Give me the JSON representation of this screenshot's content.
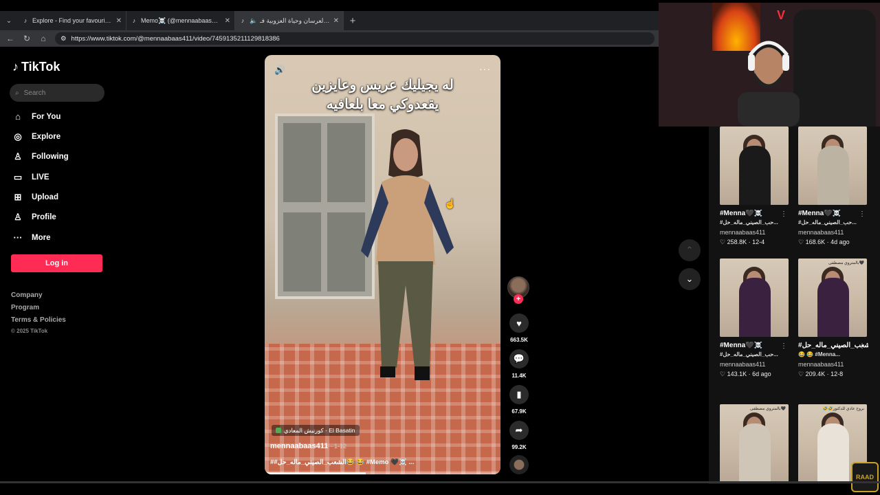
{
  "browser": {
    "tabs": [
      {
        "title": "Explore - Find your favourite video",
        "icon": "tiktok-icon",
        "active": false
      },
      {
        "title": "Memo☠️ (@mennaabaas411)",
        "icon": "tiktok-icon",
        "active": false
      },
      {
        "title": "صحة العرسان وحياة العزوبية فـ",
        "icon": "tiktok-icon",
        "active": true
      }
    ],
    "url": "https://www.tiktok.com/@mennaabaas411/video/7459135211129818386"
  },
  "sidebar": {
    "logo": "TikTok",
    "search_placeholder": "Search",
    "nav": [
      {
        "label": "For You",
        "icon": "home-icon"
      },
      {
        "label": "Explore",
        "icon": "compass-icon"
      },
      {
        "label": "Following",
        "icon": "person-icon"
      },
      {
        "label": "LIVE",
        "icon": "live-icon"
      },
      {
        "label": "Upload",
        "icon": "plus-square-icon"
      },
      {
        "label": "Profile",
        "icon": "profile-icon"
      },
      {
        "label": "More",
        "icon": "more-icon"
      }
    ],
    "login_label": "Log in",
    "footer": [
      "Company",
      "Program",
      "Terms & Policies"
    ],
    "copyright": "© 2025 TikTok"
  },
  "video": {
    "caption": "له يجيليك عريس وعايزين يقعدوكي معا بلعافيه",
    "location": "كورنيش المعادي · El Basatin",
    "author": "mennaabaas411",
    "date": "1-12",
    "tags": "##الشعب_الصيني_ماله_حل😂 😂 #Memo 🖤☠️ ...",
    "progress": 0.43,
    "counts": {
      "likes": "663.5K",
      "comments": "11.4K",
      "saves": "67.9K",
      "shares": "99.2K"
    }
  },
  "related": [
    {
      "title": "#Menna🖤☠️",
      "sub": "#حب_الصيني_ماله_حل...",
      "author": "mennaabaas411",
      "likes": "258.8K",
      "date": "12-4",
      "outfit": "#1a1a1a",
      "overlay": ""
    },
    {
      "title": "#Menna🖤☠️",
      "sub": "#حب_الصيني_ماله_حل...",
      "author": "mennaabaas411",
      "likes": "168.6K",
      "date": "4d ago",
      "outfit": "#bdb3a3",
      "overlay": ""
    },
    {
      "title": "#Menna🖤☠️",
      "sub": "#حب_الصيني_ماله_حل...",
      "author": "mennaabaas411",
      "likes": "143.1K",
      "date": "6d ago",
      "outfit": "#3b2140",
      "overlay": ""
    },
    {
      "title": "#الشعب_الصيني_ماله_حل",
      "sub": "😂 😂 #Menna...",
      "author": "mennaabaas411",
      "likes": "209.4K",
      "date": "12-8",
      "outfit": "#3b2140",
      "overlay": "🖤بالمتروي مصطفى"
    },
    {
      "title": "",
      "sub": "",
      "author": "",
      "likes": "",
      "date": "",
      "outfit": "#cfc6b8",
      "overlay": "🖤بالمتروي مصطفى"
    },
    {
      "title": "",
      "sub": "",
      "author": "",
      "likes": "",
      "date": "",
      "outfit": "#e8e2d8",
      "overlay": "بروح عادي للدكتور🤣🤣"
    }
  ],
  "webcam": {
    "watermark": "RAAD"
  }
}
